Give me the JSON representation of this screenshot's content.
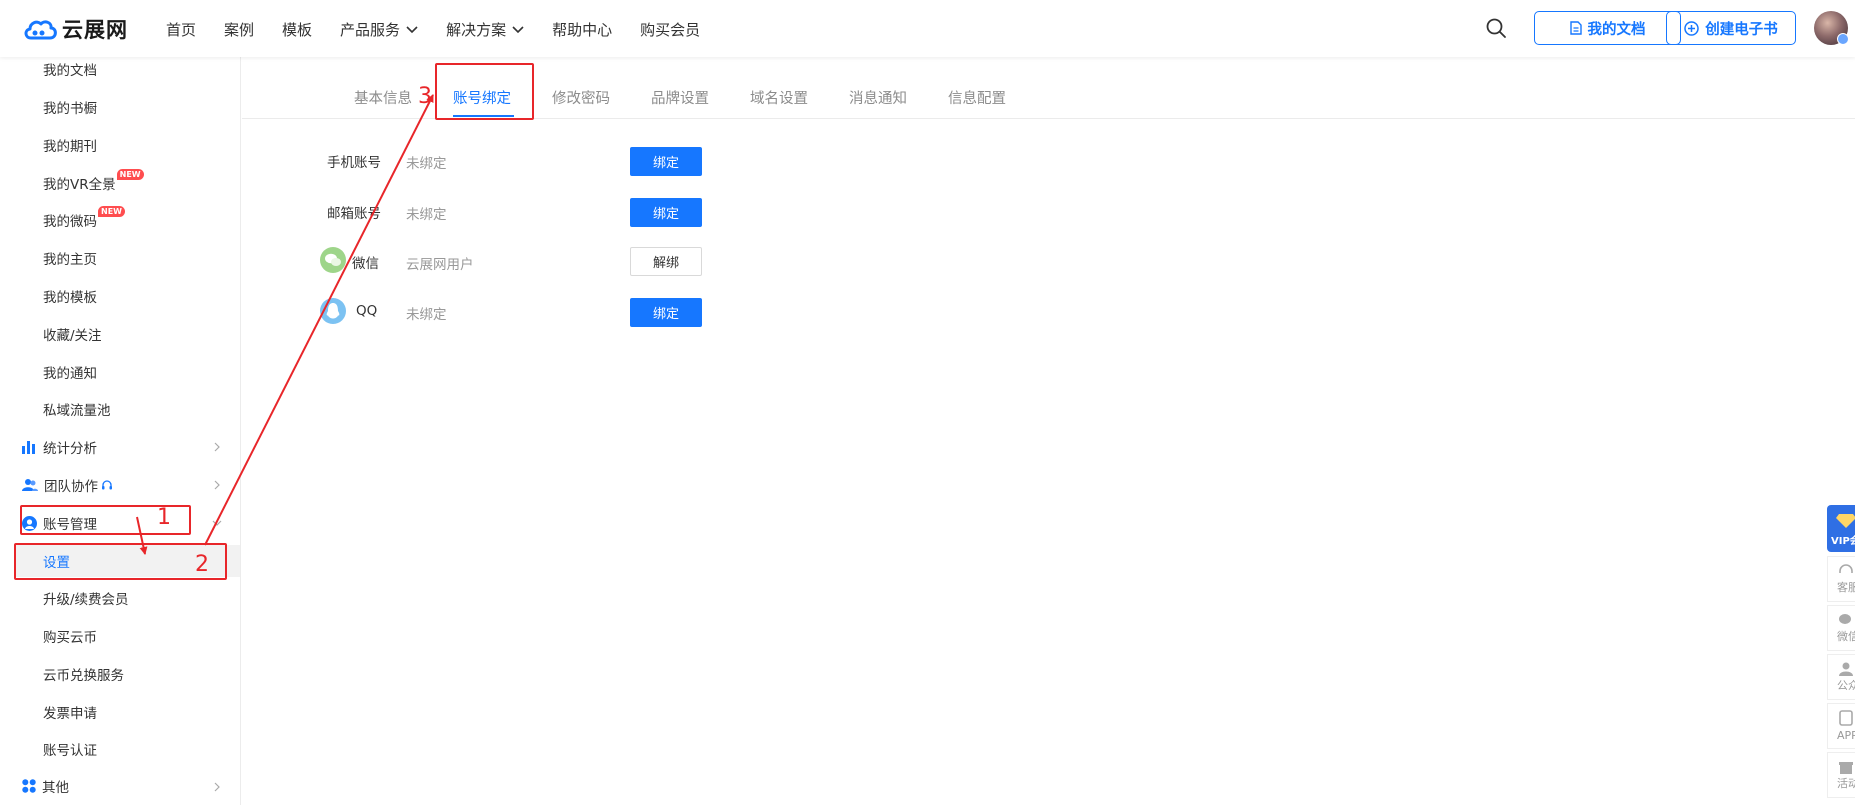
{
  "header": {
    "logo_text": "云展网",
    "nav": [
      {
        "label": "首页",
        "has_dropdown": false
      },
      {
        "label": "案例",
        "has_dropdown": false
      },
      {
        "label": "模板",
        "has_dropdown": false
      },
      {
        "label": "产品服务",
        "has_dropdown": true
      },
      {
        "label": "解决方案",
        "has_dropdown": true
      },
      {
        "label": "帮助中心",
        "has_dropdown": false
      },
      {
        "label": "购买会员",
        "has_dropdown": false
      }
    ],
    "my_docs_button": "我的文档",
    "create_ebook_button": "创建电子书"
  },
  "sidebar": {
    "items": [
      {
        "label": "我的文档"
      },
      {
        "label": "我的书橱"
      },
      {
        "label": "我的期刊"
      },
      {
        "label": "我的VR全景",
        "badge": "NEW"
      },
      {
        "label": "我的微码",
        "badge": "NEW"
      },
      {
        "label": "我的主页"
      },
      {
        "label": "我的模板"
      },
      {
        "label": "收藏/关注"
      },
      {
        "label": "我的通知"
      },
      {
        "label": "私域流量池"
      }
    ],
    "groups": {
      "stats": "统计分析",
      "team": "团队协作",
      "account": "账号管理",
      "other": "其他"
    },
    "account_items": [
      {
        "label": "设置",
        "active": true
      },
      {
        "label": "升级/续费会员"
      },
      {
        "label": "购买云币"
      },
      {
        "label": "云币兑换服务"
      },
      {
        "label": "发票申请"
      },
      {
        "label": "账号认证"
      }
    ]
  },
  "tabs": [
    {
      "label": "基本信息"
    },
    {
      "label": "账号绑定",
      "active": true
    },
    {
      "label": "修改密码"
    },
    {
      "label": "品牌设置"
    },
    {
      "label": "域名设置"
    },
    {
      "label": "消息通知"
    },
    {
      "label": "信息配置"
    }
  ],
  "bindings": [
    {
      "label": "手机账号",
      "status": "未绑定",
      "action": "绑定"
    },
    {
      "label": "邮箱账号",
      "status": "未绑定",
      "action": "绑定"
    },
    {
      "label": "微信",
      "status": "云展网用户",
      "action": "解绑"
    },
    {
      "label": "QQ",
      "status": "未绑定",
      "action": "绑定"
    }
  ],
  "floatbar": {
    "vip_text": "VIP会员",
    "items": [
      "客服",
      "微信",
      "公众号",
      "APP",
      "活动"
    ]
  },
  "annotations": [
    "1",
    "2",
    "3"
  ],
  "colors": {
    "accent": "#1677ff",
    "annotation": "#e8262a",
    "new_badge": "#ff4d4f"
  }
}
